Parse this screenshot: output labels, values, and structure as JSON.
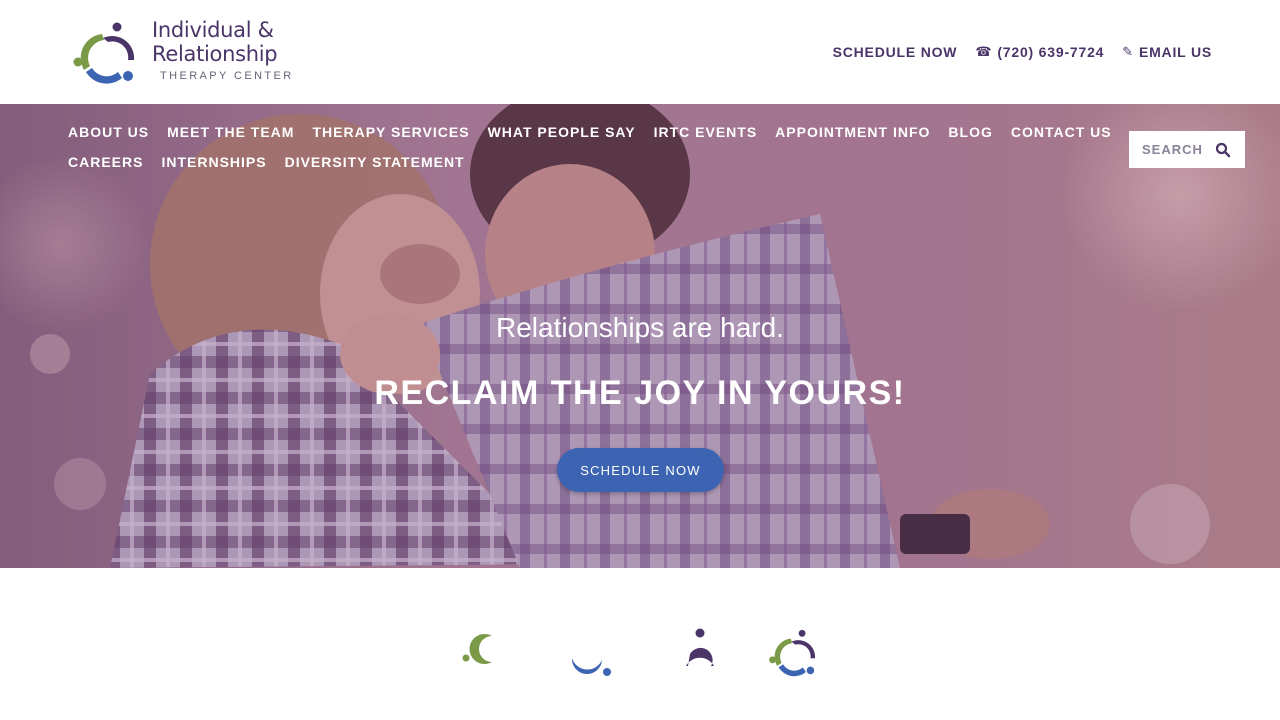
{
  "header": {
    "logo": {
      "line1": "Individual &",
      "line2": "Relationship",
      "line3": "THERAPY CENTER"
    },
    "top_links": [
      {
        "label": "SCHEDULE NOW",
        "icon": ""
      },
      {
        "label": "(720) 639-7724",
        "icon": "phone-icon"
      },
      {
        "label": "EMAIL US",
        "icon": "pencil-icon"
      }
    ]
  },
  "nav": {
    "row1": [
      "ABOUT US",
      "MEET THE TEAM",
      "THERAPY SERVICES",
      "WHAT PEOPLE SAY",
      "IRTC EVENTS",
      "APPOINTMENT INFO",
      "BLOG",
      "CONTACT US"
    ],
    "row2": [
      "CAREERS",
      "INTERNSHIPS",
      "DIVERSITY STATEMENT"
    ]
  },
  "search": {
    "placeholder": "SEARCH"
  },
  "hero": {
    "subtitle": "Relationships are hard.",
    "title": "RECLAIM THE JOY IN YOURS!",
    "cta": "SCHEDULE NOW"
  },
  "colors": {
    "brand_purple": "#4a3468",
    "brand_green": "#7a9a48",
    "brand_blue": "#3c64b2",
    "overlay": "#78468280"
  },
  "icons_row": [
    "green-crescent-icon",
    "blue-crescent-icon",
    "purple-figure-icon",
    "logo-mark-icon"
  ]
}
